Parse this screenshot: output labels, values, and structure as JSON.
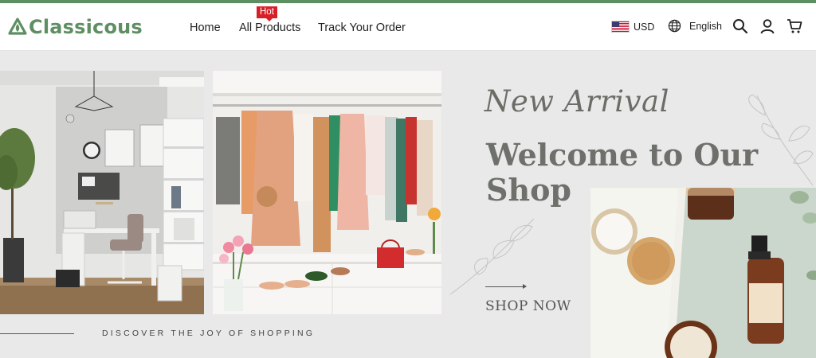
{
  "brand": {
    "name": "Classicous",
    "color": "#5e8f63"
  },
  "nav": {
    "home": "Home",
    "all_products": "All Products",
    "all_products_badge": "Hot",
    "track_order": "Track Your Order"
  },
  "header_right": {
    "currency": "USD",
    "language": "English"
  },
  "icons": {
    "logo": "leaf-triangle-logo-icon",
    "flag": "us-flag-icon",
    "globe": "globe-icon",
    "search": "search-icon",
    "user": "user-icon",
    "cart": "cart-icon"
  },
  "hero": {
    "script_title": "New Arrival",
    "headline": "Welcome to Our Shop",
    "cta": "SHOP NOW",
    "tagline": "DISCOVER THE JOY OF SHOPPING"
  },
  "colors": {
    "accent": "#5e8f63",
    "badge": "#d81f26",
    "hero_background": "#e8e9e8"
  }
}
